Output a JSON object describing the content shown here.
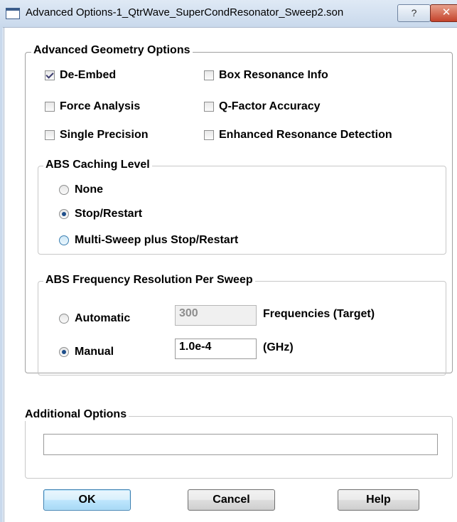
{
  "window": {
    "title": "Advanced Options-1_QtrWave_SuperCondResonator_Sweep2.son",
    "help_glyph": "?",
    "close_glyph": "✕"
  },
  "geometry_options": {
    "title": "Advanced Geometry Options",
    "de_embed": {
      "label": "De-Embed",
      "checked": true
    },
    "box_resonance": {
      "label": "Box Resonance Info",
      "checked": false
    },
    "force_analysis": {
      "label": "Force Analysis",
      "checked": false
    },
    "q_factor": {
      "label": "Q-Factor Accuracy",
      "checked": false
    },
    "single_precision": {
      "label": "Single Precision",
      "checked": false
    },
    "enhanced_resonance": {
      "label": "Enhanced Resonance Detection",
      "checked": false
    }
  },
  "abs_caching": {
    "title": "ABS Caching Level",
    "none_label": "None",
    "stop_restart_label": "Stop/Restart",
    "multi_sweep_label": "Multi-Sweep plus Stop/Restart",
    "selected": "Stop/Restart"
  },
  "abs_resolution": {
    "title": "ABS Frequency Resolution Per Sweep",
    "automatic_label": "Automatic",
    "automatic_value": "300",
    "automatic_unit": "Frequencies (Target)",
    "manual_label": "Manual",
    "manual_value": "1.0e-4",
    "manual_unit": "(GHz)",
    "selected": "Manual"
  },
  "additional_options": {
    "title": "Additional Options",
    "value": ""
  },
  "buttons": {
    "ok": "OK",
    "cancel": "Cancel",
    "help": "Help"
  }
}
